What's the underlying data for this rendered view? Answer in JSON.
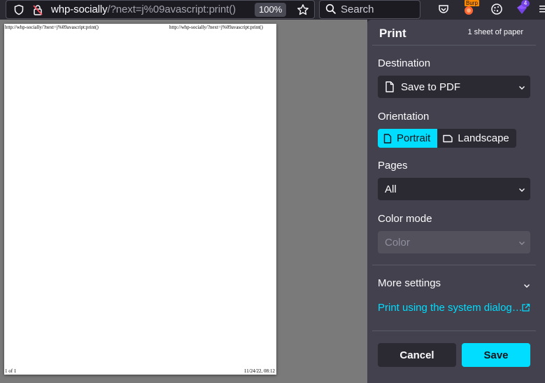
{
  "browser": {
    "url_host": "whp-socially",
    "url_path": "/?next=j%09avascript:print()",
    "zoom": "100%",
    "search_placeholder": "Search",
    "burp_badge": "Burp",
    "ext_badge_count": "4"
  },
  "preview": {
    "header_left": "http://whp-socially/?next=j%09avascript:print()",
    "header_right": "http://whp-socially/?next=j%09avascript:print()",
    "footer_left": "1 of 1",
    "footer_right": "11/24/22, 08:12"
  },
  "print": {
    "title": "Print",
    "sheets": "1 sheet of paper",
    "destination_label": "Destination",
    "destination_value": "Save to PDF",
    "orientation_label": "Orientation",
    "portrait_label": "Portrait",
    "landscape_label": "Landscape",
    "pages_label": "Pages",
    "pages_value": "All",
    "color_mode_label": "Color mode",
    "color_mode_value": "Color",
    "more_settings_label": "More settings",
    "system_dialog_link": "Print using the system dialog…",
    "cancel_label": "Cancel",
    "save_label": "Save"
  },
  "colors": {
    "accent": "#00ddff",
    "panel_bg": "#42414d",
    "toolbar_bg": "#2b2a33",
    "preview_bg": "#7a7a7a"
  },
  "icons": [
    "shield-icon",
    "lock-warning-icon",
    "star-icon",
    "search-icon",
    "pocket-icon",
    "burp-icon",
    "cookie-icon",
    "extension-icon",
    "menu-icon",
    "document-icon",
    "chevron-down-icon",
    "external-link-icon"
  ]
}
